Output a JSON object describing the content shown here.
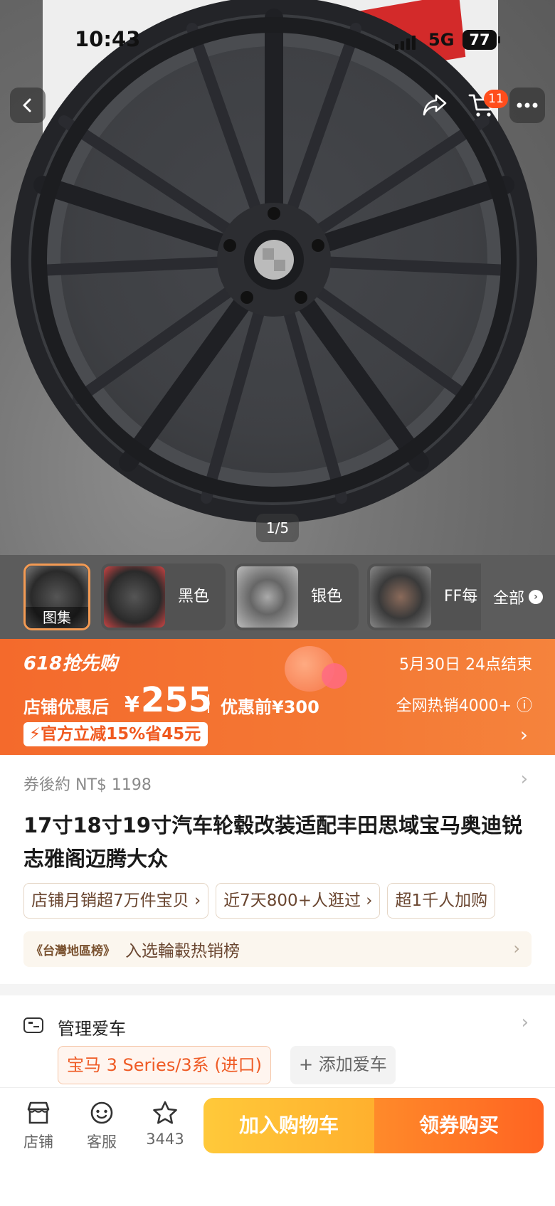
{
  "status_bar": {
    "time": "10:43",
    "network": "5G",
    "battery": "77"
  },
  "nav": {
    "cart_count": "11"
  },
  "gallery": {
    "image_counter": "1/5",
    "thumbnails": [
      {
        "label": "图集",
        "selected": true
      },
      {
        "label": "黑色"
      },
      {
        "label": "银色"
      },
      {
        "label": "FF每"
      }
    ],
    "all_label": "全部"
  },
  "promo": {
    "event": "618抢先购",
    "ends": "5月30日 24点结束",
    "price_label": "店铺优惠后",
    "currency": "¥",
    "price": "255",
    "original_price": "优惠前¥300",
    "hot_sales": "全网热销4000+ ⓘ",
    "discount": "官方立减15%省45元"
  },
  "product": {
    "coupon_price": "券後約 NT$ 1198",
    "title": "17寸18寸19寸汽车轮毂改装适配丰田思域宝马奥迪锐志雅阁迈腾大众",
    "chips": [
      "店铺月销超7万件宝贝 ›",
      "近7天800+人逛过 ›",
      "超1千人加购"
    ],
    "ranking_badge": "《台灣地區榜》",
    "ranking_text": "入选輪轂热销榜"
  },
  "car": {
    "title": "管理爱车",
    "selected_car": "宝马 3 Series/3系 (进口)",
    "add_car": "+ 添加爱车"
  },
  "bottom_bar": {
    "shop_label": "店铺",
    "service_label": "客服",
    "favorites_count": "3443",
    "add_to_cart": "加入购物车",
    "buy_now": "领券购买"
  },
  "colors": {
    "accent_orange": "#f46a2c",
    "cart_yellow": "#ffb02e",
    "buy_orange": "#ff6422"
  }
}
